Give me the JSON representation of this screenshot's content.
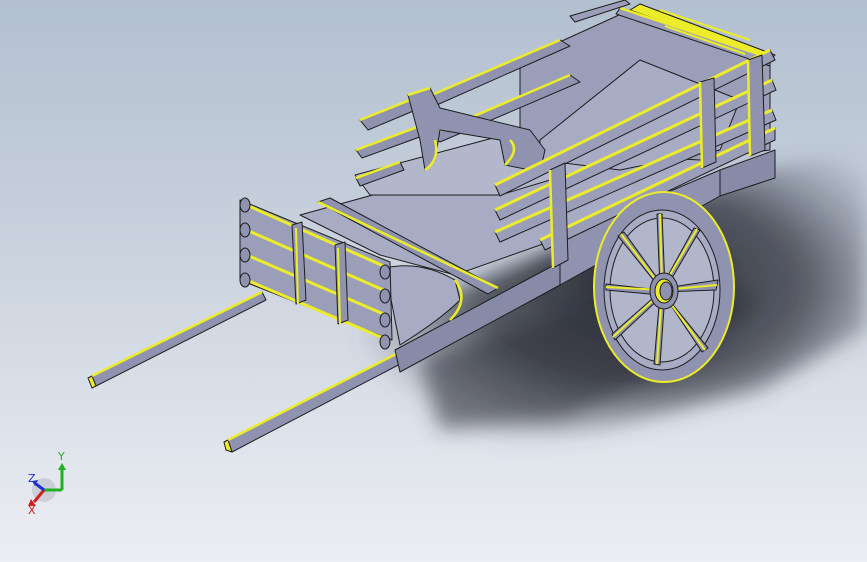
{
  "viewport": {
    "colors": {
      "background_top": "#b3c0d0",
      "background_bottom": "#eceef3",
      "body_face": "#8f93b0",
      "body_face_light": "#a7abc4",
      "edge_highlight": "#ecec2a",
      "outline": "#1e1e1e",
      "shadow": "#2a2d36"
    },
    "model_icon": "wooden-cart-model"
  },
  "triad": {
    "x_label": "X",
    "y_label": "Y",
    "z_label": "Z",
    "x_color": "#d02020",
    "y_color": "#20b020",
    "z_color": "#2030d0"
  }
}
